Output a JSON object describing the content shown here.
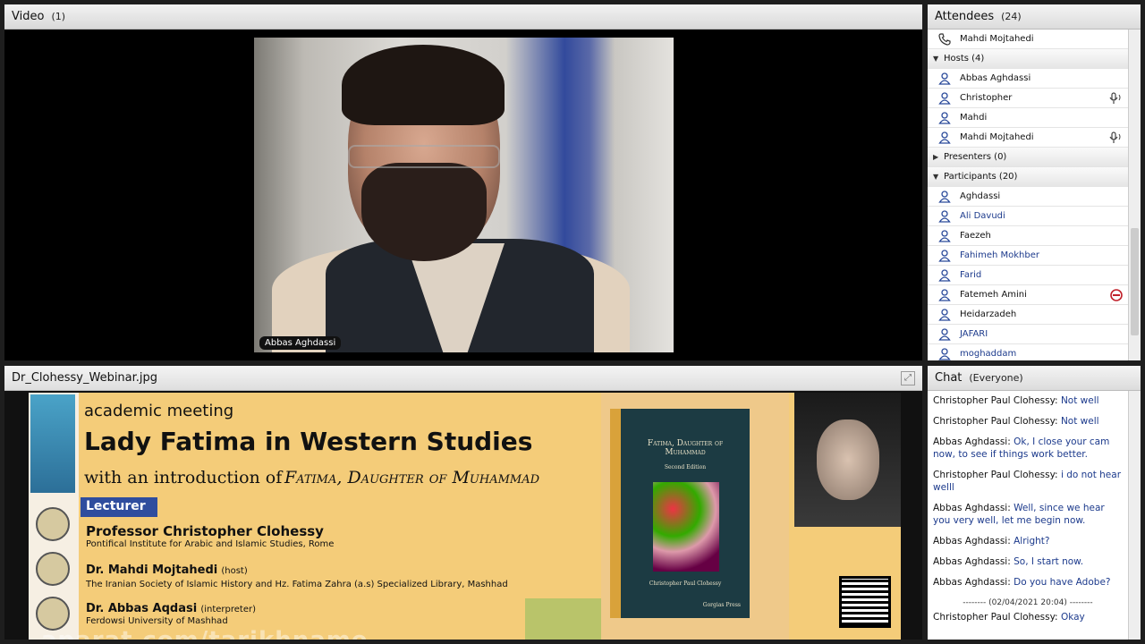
{
  "video": {
    "title": "Video",
    "count": "(1)",
    "speaker_tag": "Abbas Aghdassi"
  },
  "attendees": {
    "title": "Attendees",
    "count": "(24)",
    "me": "Mahdi Mojtahedi",
    "hosts_label": "Hosts (4)",
    "hosts": [
      {
        "name": "Abbas Aghdassi",
        "mic": false
      },
      {
        "name": "Christopher",
        "mic": true
      },
      {
        "name": "Mahdi",
        "mic": false
      },
      {
        "name": "Mahdi Mojtahedi",
        "mic": true
      }
    ],
    "presenters_label": "Presenters (0)",
    "participants_label": "Participants (20)",
    "participants": [
      {
        "name": "Aghdassi",
        "blue": false
      },
      {
        "name": "Ali Davudi",
        "blue": true
      },
      {
        "name": "Faezeh",
        "blue": false
      },
      {
        "name": "Fahimeh Mokhber",
        "blue": true
      },
      {
        "name": "Farid",
        "blue": true
      },
      {
        "name": "Fatemeh Amini",
        "blue": false
      },
      {
        "name": "Heidarzadeh",
        "blue": false
      },
      {
        "name": "JAFARI",
        "blue": true
      },
      {
        "name": "moghaddam",
        "blue": true
      }
    ]
  },
  "share": {
    "title": "Dr_Clohessy_Webinar.jpg",
    "slide": {
      "academic": "academic meeting",
      "headline": "Lady Fatima in Western Studies",
      "intro": "with an introduction of",
      "book_title": "Fatima, Daughter of Muhammad",
      "lecturer_label": "Lecturer",
      "p1_name": "Professor Christopher Clohessy",
      "p1_aff": "Pontifical Institute for Arabic and Islamic Studies, Rome",
      "p2_name": "Dr. Mahdi Mojtahedi",
      "p2_role": "(host)",
      "p2_aff": "The Iranian Society of Islamic History and Hz. Fatima Zahra (a.s) Specialized Library, Mashhad",
      "p3_name": "Dr. Abbas Aqdasi",
      "p3_role": "(interpreter)",
      "p3_aff": "Ferdowsi University of Mashhad",
      "cover_title": "Fatima, Daughter of Muhammad",
      "cover_edition": "Second Edition",
      "cover_author": "Christopher Paul Clohessy",
      "cover_publisher": "Gorgias Press",
      "watermark": "aparat.com/tarikhname"
    }
  },
  "chat": {
    "title": "Chat",
    "scope": "(Everyone)",
    "messages": [
      {
        "who": "Christopher Paul Clohessy:",
        "text": "Not well"
      },
      {
        "who": "Christopher Paul Clohessy:",
        "text": "Not well"
      },
      {
        "who": "Abbas Aghdassi:",
        "text": "Ok, I close your cam now, to see if things work better."
      },
      {
        "who": "Christopher Paul Clohessy:",
        "text": "i do not hear welll"
      },
      {
        "who": "Abbas Aghdassi:",
        "text": "Well, since we hear you very well, let me begin now."
      },
      {
        "who": "Abbas Aghdassi:",
        "text": "Alright?"
      },
      {
        "who": "Abbas Aghdassi:",
        "text": "So, I start now."
      },
      {
        "who": "Abbas Aghdassi:",
        "text": "Do you have Adobe?"
      }
    ],
    "separator": "-------- (02/04/2021 20:04) --------",
    "last": {
      "who": "Christopher Paul Clohessy:",
      "text": "Okay"
    }
  }
}
